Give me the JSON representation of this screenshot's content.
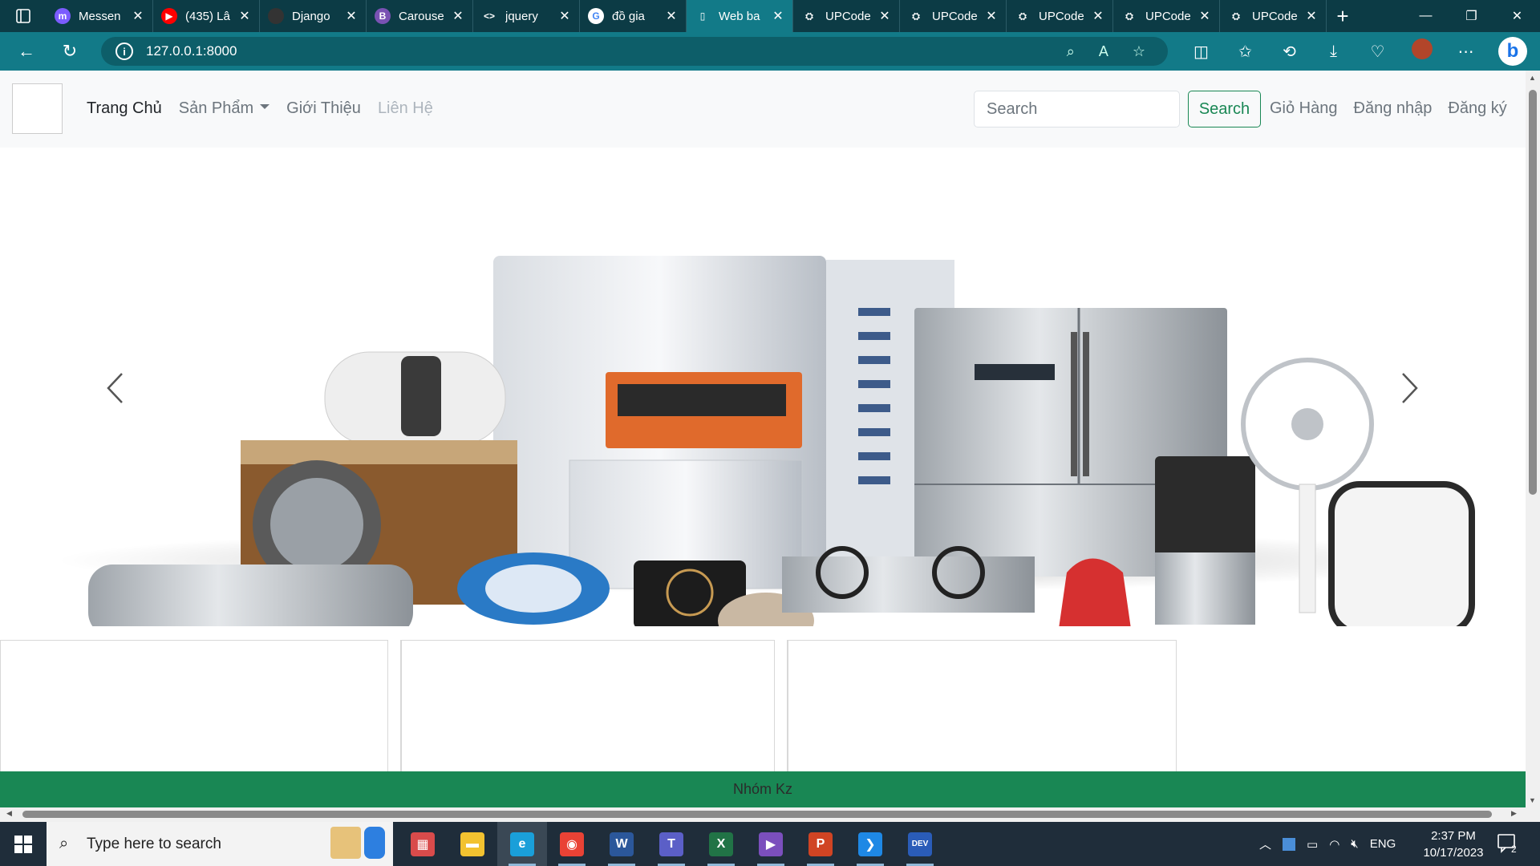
{
  "browser": {
    "tabs": [
      {
        "title": "Messen",
        "color": "#7b5cff",
        "glyph": "m",
        "active": false
      },
      {
        "title": "(435) Lâ",
        "color": "#ff0000",
        "glyph": "▶",
        "active": false
      },
      {
        "title": "Django",
        "color": "#333333",
        "glyph": "",
        "active": false
      },
      {
        "title": "Carouse",
        "color": "#7952b3",
        "glyph": "B",
        "active": false
      },
      {
        "title": "jquery",
        "color": "",
        "glyph": "<>",
        "active": false
      },
      {
        "title": "đồ gia",
        "color": "#ffffff",
        "glyph": "G",
        "active": false
      },
      {
        "title": "Web ba",
        "color": "",
        "glyph": "▯",
        "active": true
      },
      {
        "title": "UPCode",
        "color": "",
        "glyph": "⛭",
        "active": false
      },
      {
        "title": "UPCode",
        "color": "",
        "glyph": "⛭",
        "active": false
      },
      {
        "title": "UPCode",
        "color": "",
        "glyph": "⛭",
        "active": false
      },
      {
        "title": "UPCode",
        "color": "",
        "glyph": "⛭",
        "active": false
      },
      {
        "title": "UPCode",
        "color": "",
        "glyph": "⛭",
        "active": false
      }
    ],
    "new_tab": "+",
    "url": "127.0.0.1:8000"
  },
  "navbar": {
    "links": [
      "Trang Chủ",
      "Sản Phẩm",
      "Giới Thiệu",
      "Liên Hệ"
    ],
    "search_placeholder": "Search",
    "search_button": "Search",
    "right_links": [
      "Giỏ Hàng",
      "Đăng nhập",
      "Đăng ký"
    ]
  },
  "footer": {
    "text": "Nhóm Kz"
  },
  "taskbar": {
    "search_placeholder": "Type here to search",
    "apps": [
      {
        "name": "app-grid",
        "color": "#d94b4b",
        "glyph": "▦"
      },
      {
        "name": "file-explorer",
        "color": "#f2c230",
        "glyph": "▬"
      },
      {
        "name": "edge",
        "color": "#1a9fd9",
        "glyph": "e"
      },
      {
        "name": "chrome",
        "color": "#e94235",
        "glyph": "◉"
      },
      {
        "name": "word",
        "color": "#2b579a",
        "glyph": "W"
      },
      {
        "name": "teams",
        "color": "#5b5fc7",
        "glyph": "T"
      },
      {
        "name": "excel",
        "color": "#217346",
        "glyph": "X"
      },
      {
        "name": "visual-studio",
        "color": "#7b4fbd",
        "glyph": "▶"
      },
      {
        "name": "powerpoint",
        "color": "#d04423",
        "glyph": "P"
      },
      {
        "name": "vscode",
        "color": "#1e88e5",
        "glyph": "❯"
      },
      {
        "name": "devc",
        "color": "#2a5cb8",
        "glyph": "DEV"
      }
    ],
    "language": "ENG",
    "time": "2:37 PM",
    "date": "10/17/2023",
    "notification_count": "2"
  }
}
